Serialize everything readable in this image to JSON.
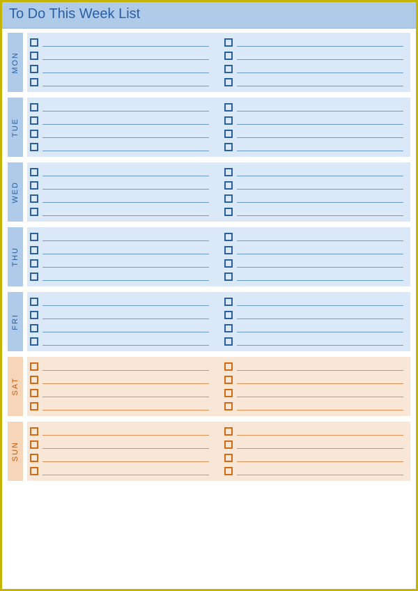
{
  "title": "To Do This Week List",
  "days": [
    {
      "label": "MON",
      "kind": "wk",
      "rows": 4,
      "cols": 2
    },
    {
      "label": "TUE",
      "kind": "wk",
      "rows": 4,
      "cols": 2
    },
    {
      "label": "WED",
      "kind": "wk",
      "rows": 4,
      "cols": 2
    },
    {
      "label": "THU",
      "kind": "wk",
      "rows": 4,
      "cols": 2
    },
    {
      "label": "FRI",
      "kind": "wk",
      "rows": 4,
      "cols": 2
    },
    {
      "label": "SAT",
      "kind": "we",
      "rows": 4,
      "cols": 2
    },
    {
      "label": "SUN",
      "kind": "we",
      "rows": 4,
      "cols": 2
    }
  ]
}
